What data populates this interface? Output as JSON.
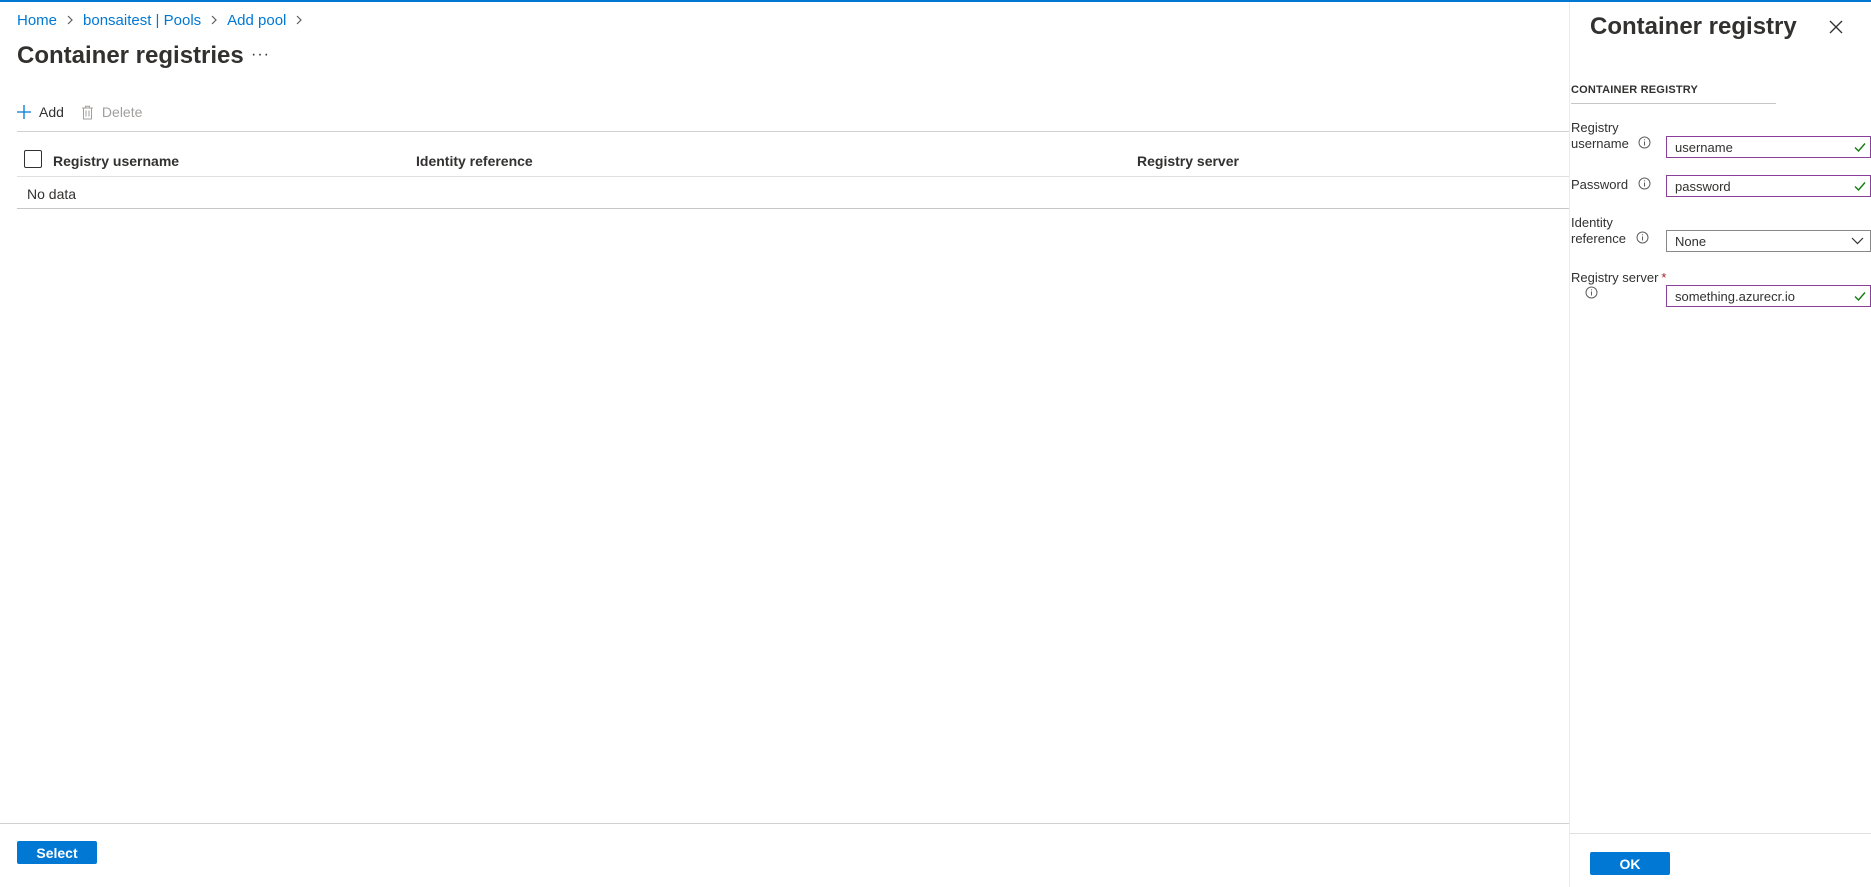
{
  "breadcrumb": {
    "items": [
      {
        "label": "Home"
      },
      {
        "label": "bonsaitest | Pools"
      },
      {
        "label": "Add pool"
      }
    ]
  },
  "page": {
    "title": "Container registries",
    "more_label": "···"
  },
  "toolbar": {
    "add_label": "Add",
    "delete_label": "Delete"
  },
  "grid": {
    "columns": [
      "Registry username",
      "Identity reference",
      "Registry server"
    ],
    "empty_text": "No data"
  },
  "footer": {
    "select_label": "Select"
  },
  "blade": {
    "title": "Container registry",
    "section_header": "CONTAINER REGISTRY",
    "fields": {
      "username": {
        "label_line1": "Registry",
        "label_line2": "username",
        "value": "username"
      },
      "password": {
        "label": "Password",
        "value": "password"
      },
      "identity": {
        "label_line1": "Identity",
        "label_line2": "reference",
        "value": "None"
      },
      "server": {
        "label": "Registry server",
        "required_mark": "*",
        "value": "something.azurecr.io"
      }
    },
    "ok_label": "OK"
  },
  "colors": {
    "accent": "#0078d4",
    "valid_border": "#8a3f9b",
    "valid_check": "#107c10",
    "required": "#a4262c"
  },
  "icons": {
    "add": "plus-icon",
    "delete": "trash-icon",
    "close": "close-icon",
    "info": "info-icon",
    "check": "checkmark-icon",
    "dropdown": "chevron-down-icon",
    "breadcrumb_sep": "chevron-right-icon"
  }
}
